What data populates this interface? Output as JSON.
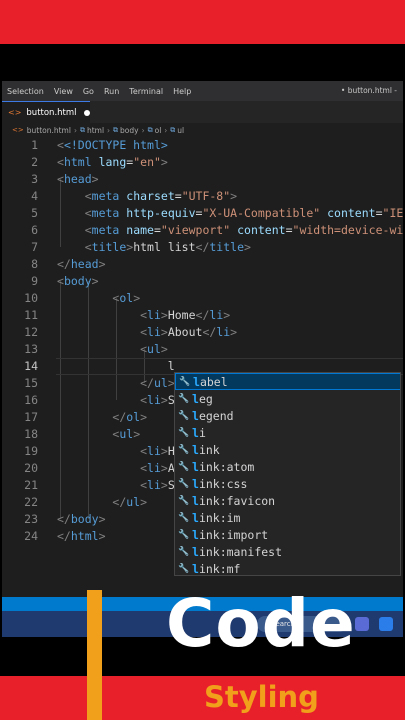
{
  "menubar": {
    "items": [
      "Selection",
      "View",
      "Go",
      "Run",
      "Terminal",
      "Help"
    ],
    "window_title": "• button.html -"
  },
  "tab": {
    "filename": "button.html",
    "unsaved": true
  },
  "breadcrumb": [
    "button.html",
    "html",
    "body",
    "ol",
    "ul"
  ],
  "editor": {
    "current_line": 14,
    "lines": [
      {
        "n": "1"
      },
      {
        "n": "2"
      },
      {
        "n": "3"
      },
      {
        "n": "4"
      },
      {
        "n": "5"
      },
      {
        "n": "6"
      },
      {
        "n": "7"
      },
      {
        "n": "8"
      },
      {
        "n": "9"
      },
      {
        "n": "10"
      },
      {
        "n": "11"
      },
      {
        "n": "12"
      },
      {
        "n": "13"
      },
      {
        "n": "14"
      },
      {
        "n": "15"
      },
      {
        "n": "16"
      },
      {
        "n": "17"
      },
      {
        "n": "18"
      },
      {
        "n": "19"
      },
      {
        "n": "20"
      },
      {
        "n": "21"
      },
      {
        "n": "22"
      },
      {
        "n": "23"
      },
      {
        "n": "24"
      }
    ],
    "code": {
      "l1": "<!DOCTYPE html>",
      "l2_tag": "html",
      "l2_attr": "lang",
      "l2_val": "\"en\"",
      "l3": "head",
      "l4_attr": "charset",
      "l4_val": "\"UTF-8\"",
      "l5_attr1": "http-equiv",
      "l5_val1": "\"X-UA-Compatible\"",
      "l5_attr2": "content",
      "l5_val2": "\"IE",
      "l6_attr1": "name",
      "l6_val1": "\"viewport\"",
      "l6_attr2": "content",
      "l6_val2": "\"width=device-wi",
      "l7_text": "html list",
      "l11_text": "Home",
      "l12_text": "About",
      "l14_text": "l",
      "l16_text": "S",
      "l19_text": "H",
      "l20_text": "A",
      "l21_text": "S"
    }
  },
  "suggestions": {
    "selected_index": 0,
    "items": [
      {
        "match": "l",
        "rest": "abel"
      },
      {
        "match": "l",
        "rest": "eg"
      },
      {
        "match": "l",
        "rest": "egend"
      },
      {
        "match": "l",
        "rest": "i"
      },
      {
        "match": "l",
        "rest": "ink"
      },
      {
        "match": "l",
        "rest": "ink:atom"
      },
      {
        "match": "l",
        "rest": "ink:css"
      },
      {
        "match": "l",
        "rest": "ink:favicon"
      },
      {
        "match": "l",
        "rest": "ink:im"
      },
      {
        "match": "l",
        "rest": "ink:import"
      },
      {
        "match": "l",
        "rest": "ink:manifest"
      },
      {
        "match": "l",
        "rest": "ink:mf"
      }
    ]
  },
  "taskbar": {
    "search_placeholder": "Search"
  },
  "branding": {
    "title": "Code",
    "subtitle": "Styling"
  },
  "colors": {
    "brand_red": "#e8202a",
    "brand_orange": "#f0a01a",
    "editor_bg": "#1e1e1e",
    "accent_blue": "#007acc"
  }
}
